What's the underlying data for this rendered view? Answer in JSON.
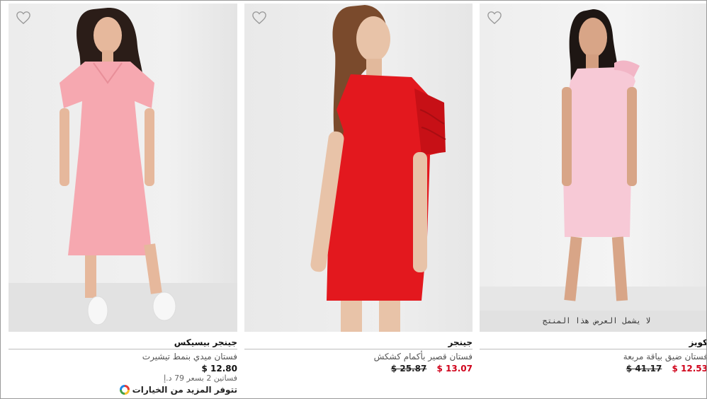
{
  "products": [
    {
      "brand": "جينجر بيسيكس",
      "name": "فستان ميدي بنمط تيشيرت",
      "price": "12.80 $",
      "promo": "فساتين 2 بسعر 79 د.إ",
      "more_options": "تتوفر المزيد من الخيارات",
      "dress_color": "#f6a8b0"
    },
    {
      "brand": "جينجر",
      "name": "فستان قصير بأكمام كشكش",
      "sale_price": "13.07 $",
      "old_price": "25.87 $",
      "dress_color": "#e3181e"
    },
    {
      "brand": "كويز",
      "name": "فستان ضيق بياقة مربعة",
      "sale_price": "12.53 $",
      "old_price": "41.17 $",
      "overlay_note": "لا يشمل العرض هذا المنتج",
      "dress_color": "#f7c9d6"
    }
  ],
  "colors": {
    "sale": "#d0021b",
    "divider": "#bdbdbd"
  }
}
